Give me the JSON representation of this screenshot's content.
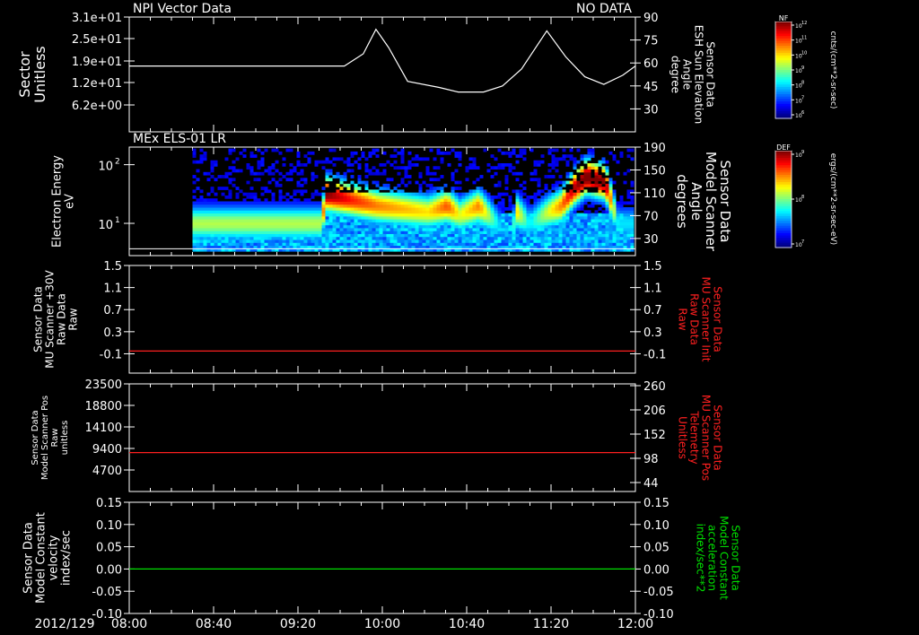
{
  "colors": {
    "foreground": "#ffffff",
    "background": "#000000",
    "red": "#ff2020",
    "green": "#00e000"
  },
  "time_axis": {
    "date": "2012/129",
    "ticks": [
      "08:00",
      "08:40",
      "09:20",
      "10:00",
      "10:40",
      "11:20",
      "12:00"
    ],
    "range_hours": [
      8,
      12
    ]
  },
  "chart_data": [
    {
      "type": "line",
      "top_left_label": "NPI Vector Data",
      "top_right_label": "NO DATA",
      "ylabel_left": [
        "Sector",
        "Unitless"
      ],
      "ylabel_right": [
        "Sensor Data",
        "ESH Sun Elevation",
        "Angle",
        "degree"
      ],
      "left_ticks": [
        "3.1e+01",
        "2.5e+01",
        "1.9e+01",
        "1.2e+01",
        "6.2e+00"
      ],
      "right_ticks": [
        "90",
        "75",
        "60",
        "45",
        "30"
      ],
      "right_ylim": [
        15,
        90
      ],
      "series": [
        {
          "color": "#ffffff",
          "x": [
            8.0,
            9.7,
            9.85,
            9.95,
            10.05,
            10.2,
            10.45,
            10.6,
            10.8,
            10.95,
            11.1,
            11.3,
            11.45,
            11.6,
            11.75,
            11.9,
            12.0
          ],
          "y": [
            58,
            58,
            66,
            82,
            70,
            48,
            44,
            41,
            41,
            45,
            56,
            81,
            64,
            51,
            46,
            52,
            58
          ]
        }
      ],
      "colorbar": {
        "name": "NF",
        "unit": "cnts/(cm**2-sr-sec)",
        "tick_mantissa": "10",
        "tick_exponents": [
          "12",
          "11",
          "10",
          "9",
          "8",
          "7",
          "6"
        ]
      }
    },
    {
      "type": "heatmap",
      "title": "MEx ELS-01 LR",
      "ylabel_left": [
        "Electron Energy",
        "eV"
      ],
      "ylabel_right": [
        "Sensor Data",
        "Model Scanner",
        "Angle",
        "degrees"
      ],
      "left_ticks": [
        "10",
        "10"
      ],
      "left_tick_exponents": [
        "2",
        "1"
      ],
      "left_tick_decades": [
        2,
        1
      ],
      "log_ylim": [
        0.45,
        2.3
      ],
      "right_ticks": [
        "190",
        "150",
        "110",
        "70",
        "30"
      ],
      "right_ylim": [
        0,
        190
      ],
      "energy_levels_log": [
        0.55,
        0.6,
        0.65,
        0.7,
        0.75,
        0.8,
        0.85,
        0.9,
        0.95,
        1.0,
        1.05,
        1.1,
        1.15,
        1.2,
        1.25,
        1.3,
        1.35,
        1.4,
        1.45,
        1.5,
        1.55,
        1.6,
        1.65,
        1.7,
        1.75,
        1.8,
        1.85,
        1.9,
        1.95,
        2.0,
        2.05,
        2.1,
        2.15,
        2.2,
        2.25
      ],
      "data_start_hour": 8.5,
      "hour_bins": [
        8.5,
        8.7,
        8.9,
        9.1,
        9.3,
        9.5,
        9.55,
        9.75,
        9.95,
        10.15,
        10.35,
        10.5,
        10.6,
        10.75,
        10.9,
        11.0,
        11.05,
        11.15,
        11.3,
        11.4,
        11.5,
        11.6,
        11.75,
        11.85
      ],
      "peak_log_energy": [
        1.0,
        1.0,
        1.0,
        1.0,
        1.0,
        1.0,
        1.5,
        1.4,
        1.3,
        1.25,
        1.2,
        1.3,
        1.15,
        1.3,
        1.0,
        0.8,
        1.2,
        1.0,
        1.2,
        1.3,
        1.6,
        1.8,
        1.7,
        1.0
      ],
      "peak_level": [
        0.5,
        0.5,
        0.5,
        0.5,
        0.5,
        0.5,
        0.95,
        0.8,
        0.7,
        0.65,
        0.6,
        0.75,
        0.55,
        0.7,
        0.3,
        0.15,
        0.6,
        0.3,
        0.55,
        0.7,
        0.9,
        1.0,
        0.95,
        0.3
      ],
      "scanner_angle": [
        {
          "x": 8.0,
          "y": 12
        },
        {
          "x": 12.0,
          "y": 12
        }
      ],
      "colorbar": {
        "name": "DEF",
        "unit": "ergs/(cm**2-sr-sec-eV)",
        "tick_mantissa": "10",
        "tick_exponents": [
          "9",
          "8",
          "7"
        ]
      }
    },
    {
      "type": "line",
      "ylabel_left": [
        "Sensor Data",
        "MU Scanner +30V",
        "Raw Data",
        "Raw"
      ],
      "ylabel_right": [
        "Sensor Data",
        "MU Scanner Init",
        "Raw Data",
        "Raw"
      ],
      "left_ticks": [
        "1.5",
        "1.1",
        "0.7",
        "0.3",
        "-0.1"
      ],
      "right_ticks": [
        "1.5",
        "1.1",
        "0.7",
        "0.3",
        "-0.1"
      ],
      "ylim": [
        -0.45,
        1.5
      ],
      "series": [
        {
          "color": "#ff2020",
          "x": [
            8.0,
            12.0
          ],
          "y": [
            -0.05,
            -0.05
          ]
        }
      ]
    },
    {
      "type": "line",
      "ylabel_left": [
        "Sensor Data",
        "Model Scanner Pos",
        "Raw",
        "unitless"
      ],
      "ylabel_right": [
        "Sensor Data",
        "MU Scanner Pos",
        "Telemetry",
        "Unitless"
      ],
      "left_ticks": [
        "23500",
        "18800",
        "14100",
        "9400",
        "4700"
      ],
      "right_ticks": [
        "260",
        "206",
        "152",
        "98",
        "44"
      ],
      "ylim": [
        0,
        23500
      ],
      "series": [
        {
          "color": "#ff2020",
          "x": [
            8.0,
            12.0
          ],
          "y": [
            8500,
            8500
          ]
        }
      ]
    },
    {
      "type": "line",
      "ylabel_left": [
        "Sensor Data",
        "Model Constant",
        "velocity",
        "index/sec"
      ],
      "ylabel_right": [
        "Sensor Data",
        "Model Constant",
        "acceleration",
        "index/sec**2"
      ],
      "left_ticks": [
        "0.15",
        "0.10",
        "0.05",
        "0.00",
        "-0.05",
        "-0.10"
      ],
      "right_ticks": [
        "0.15",
        "0.10",
        "0.05",
        "0.00",
        "-0.05",
        "-0.10"
      ],
      "ylim": [
        -0.1,
        0.15
      ],
      "series": [
        {
          "color": "#00e000",
          "x": [
            8.0,
            12.0
          ],
          "y": [
            0.0,
            0.0
          ]
        }
      ]
    }
  ]
}
